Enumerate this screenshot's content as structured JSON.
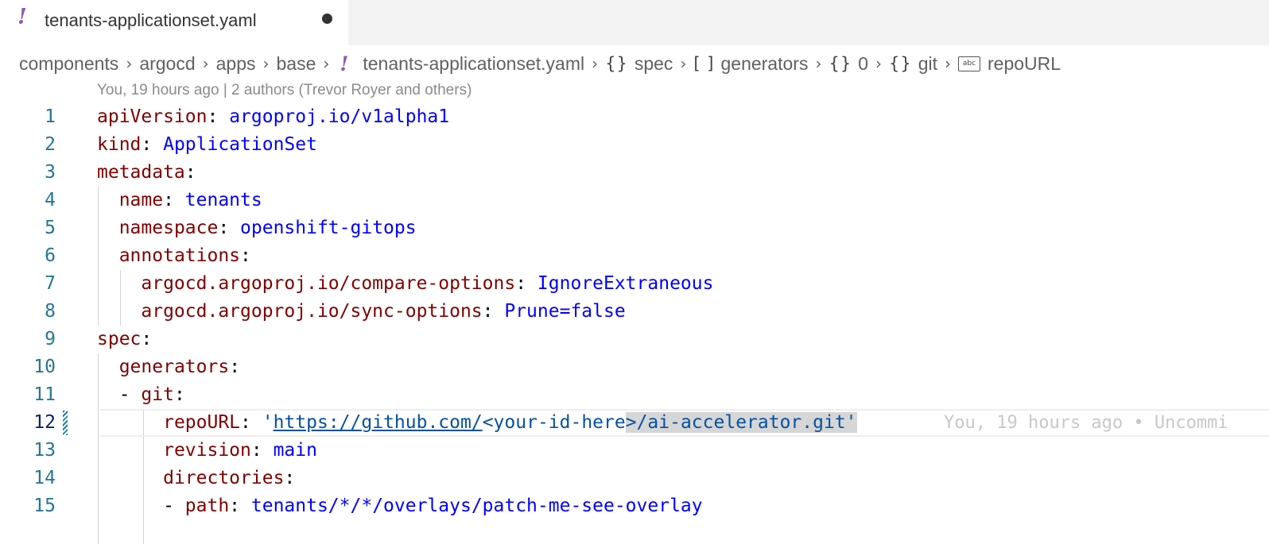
{
  "tab": {
    "icon": "yaml-file-icon",
    "label": "tenants-applicationset.yaml",
    "dirty": true
  },
  "breadcrumb": [
    {
      "label": "components",
      "kind": "folder"
    },
    {
      "label": "argocd",
      "kind": "folder"
    },
    {
      "label": "apps",
      "kind": "folder"
    },
    {
      "label": "base",
      "kind": "folder"
    },
    {
      "label": "tenants-applicationset.yaml",
      "kind": "file",
      "symbol": "!"
    },
    {
      "label": "spec",
      "kind": "object",
      "symbol": "{}"
    },
    {
      "label": "generators",
      "kind": "array",
      "symbol": "[ ]"
    },
    {
      "label": "0",
      "kind": "object",
      "symbol": "{}"
    },
    {
      "label": "git",
      "kind": "object",
      "symbol": "{}"
    },
    {
      "label": "repoURL",
      "kind": "string",
      "symbol": "abc"
    }
  ],
  "codelens": "You, 19 hours ago | 2 authors (Trevor Royer and others)",
  "editor": {
    "active_line": 12,
    "inline_blame": "You, 19 hours ago • Uncommi",
    "lines": [
      {
        "n": "1",
        "key": "apiVersion",
        "val": "argoproj.io/v1alpha1"
      },
      {
        "n": "2",
        "key": "kind",
        "val": "ApplicationSet"
      },
      {
        "n": "3",
        "key": "metadata",
        "val": ""
      },
      {
        "n": "4",
        "key": "name",
        "val": "tenants"
      },
      {
        "n": "5",
        "key": "namespace",
        "val": "openshift-gitops"
      },
      {
        "n": "6",
        "key": "annotations",
        "val": ""
      },
      {
        "n": "7",
        "key": "argocd.argoproj.io/compare-options",
        "val": "IgnoreExtraneous"
      },
      {
        "n": "8",
        "key": "argocd.argoproj.io/sync-options",
        "val": "Prune=false"
      },
      {
        "n": "9",
        "key": "spec",
        "val": ""
      },
      {
        "n": "10",
        "key": "generators",
        "val": ""
      },
      {
        "n": "11",
        "key": "git",
        "val": ""
      },
      {
        "n": "12",
        "key": "repoURL",
        "val_prefix": "'",
        "val_link": "https://github.com/",
        "val_mid": "<your-id-here",
        "val_selected": ">/ai-accelerator.git'"
      },
      {
        "n": "13",
        "key": "revision",
        "val": "main"
      },
      {
        "n": "14",
        "key": "directories",
        "val": ""
      },
      {
        "n": "15",
        "key": "path",
        "val": "tenants/*/*/overlays/patch-me-see-overlay"
      }
    ]
  },
  "colors": {
    "key": "#800000",
    "value": "#0000ff",
    "line_number": "#237893",
    "yaml_icon": "#8d5cb5"
  }
}
